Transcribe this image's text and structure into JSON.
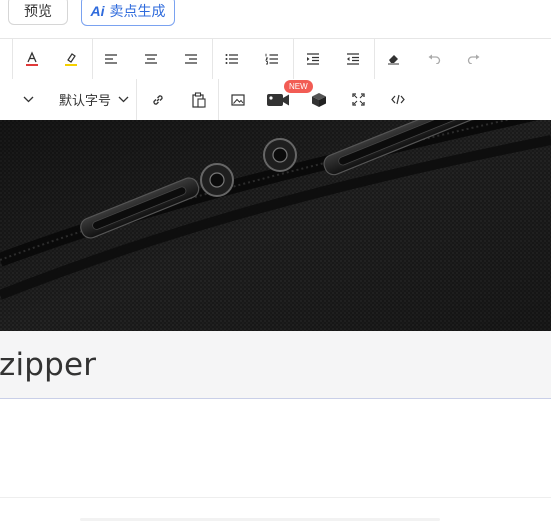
{
  "toolbar_top": {
    "preview_label": "预览",
    "ai_mark": "Ai",
    "ai_label": "卖点生成"
  },
  "toolbar_row2": {
    "font_size_label": "默认字号",
    "new_badge": "NEW"
  },
  "content": {
    "title": "zipper"
  },
  "colors": {
    "accent": "#2f6bdc",
    "badge": "#f25c54",
    "text_color_indicator": "#e03a3a",
    "highlight_indicator": "#f5d000"
  }
}
